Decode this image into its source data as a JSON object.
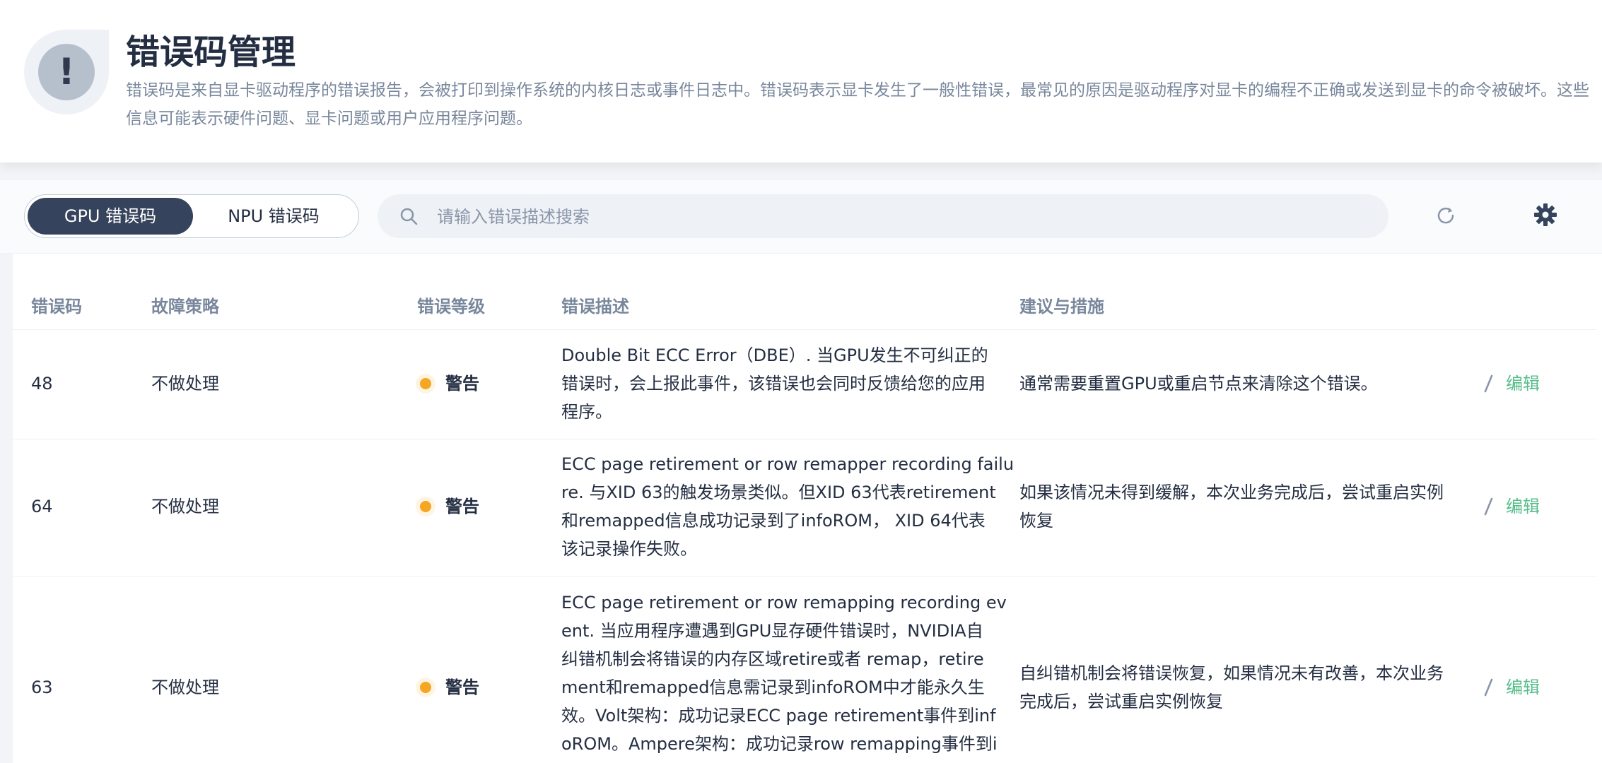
{
  "header": {
    "title": "错误码管理",
    "icon": "exclamation-icon",
    "description": "错误码是来自显卡驱动程序的错误报告，会被打印到操作系统的内核日志或事件日志中。错误码表示显卡发生了一般性错误，最常见的原因是驱动程序对显卡的编程不正确或发送到显卡的命令被破坏。这些信息可能表示硬件问题、显卡问题或用户应用程序问题。"
  },
  "toolbar": {
    "tabs": [
      {
        "label": "GPU 错误码",
        "active": true
      },
      {
        "label": "NPU 错误码",
        "active": false
      }
    ],
    "search_placeholder": "请输入错误描述搜索",
    "search_value": "",
    "refresh_icon": "refresh-icon",
    "settings_icon": "gear-icon"
  },
  "table": {
    "columns": [
      "错误码",
      "故障策略",
      "错误等级",
      "错误描述",
      "建议与措施"
    ],
    "rows": [
      {
        "code": "48",
        "policy": "不做处理",
        "level": "警告",
        "description_lines": [
          "Double Bit ECC Error（DBE）. 当GPU发生不可纠正的",
          "错误时，会上报此事件，该错误也会同时反馈给您的应用",
          "程序。"
        ],
        "suggestion_lines": [
          "通常需要重置GPU或重启节点来清除这个错误。"
        ],
        "action": "编辑"
      },
      {
        "code": "64",
        "policy": "不做处理",
        "level": "警告",
        "description_lines": [
          "ECC page retirement or row remapper recording failu",
          "re. 与XID 63的触发场景类似。但XID 63代表retirement",
          "和remapped信息成功记录到了infoROM，  XID 64代表",
          "该记录操作失败。"
        ],
        "suggestion_lines": [
          "如果该情况未得到缓解，本次业务完成后，尝试重启实例",
          "恢复"
        ],
        "action": "编辑"
      },
      {
        "code": "63",
        "policy": "不做处理",
        "level": "警告",
        "description_lines": [
          "ECC page retirement or row remapping recording ev",
          "ent. 当应用程序遭遇到GPU显存硬件错误时，NVIDIA自",
          "纠错机制会将错误的内存区域retire或者 remap，retire",
          "ment和remapped信息需记录到infoROM中才能永久生",
          "效。Volt架构：成功记录ECC page retirement事件到inf",
          "oROM。Ampere架构：成功记录row remapping事件到i"
        ],
        "suggestion_lines": [
          "自纠错机制会将错误恢复，如果情况未有改善，本次业务",
          "完成后，尝试重启实例恢复"
        ],
        "action": "编辑"
      }
    ]
  },
  "colors": {
    "primary_dark": "#36435c",
    "warning": "#f5a623",
    "edit_link": "#55bc8a",
    "muted_text": "#79879c"
  }
}
